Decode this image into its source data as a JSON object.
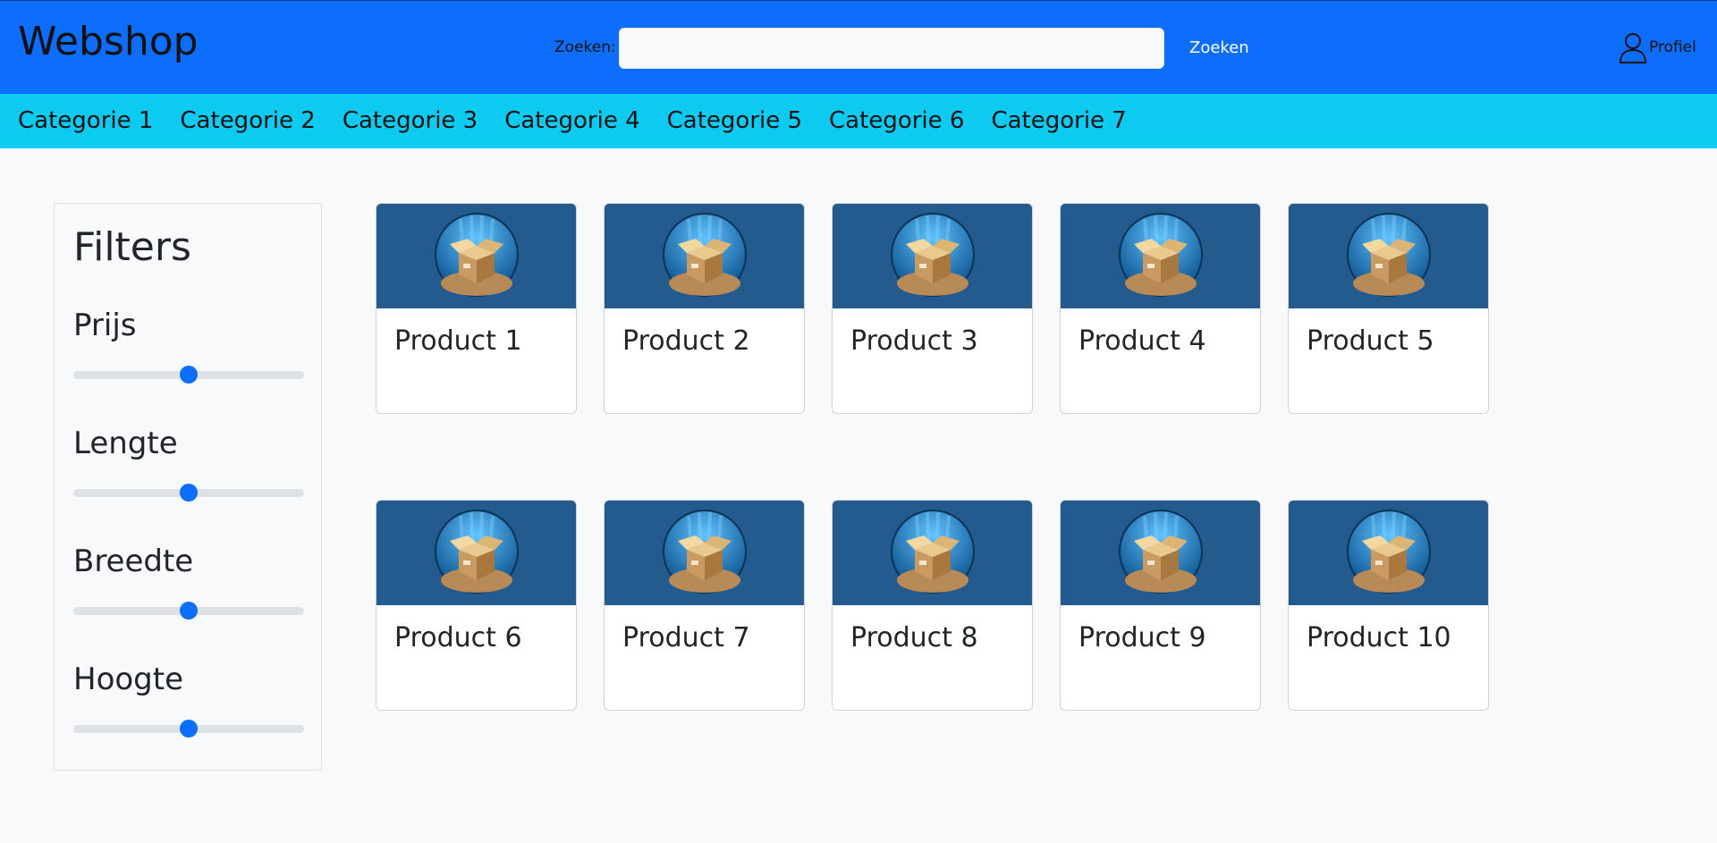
{
  "header": {
    "brand": "Webshop",
    "search_label": "Zoeken:",
    "search_value": "",
    "search_placeholder": "",
    "search_button": "Zoeken",
    "profile_label": "Profiel",
    "profile_icon": "person-icon"
  },
  "categories": [
    "Categorie 1",
    "Categorie 2",
    "Categorie 3",
    "Categorie 4",
    "Categorie 5",
    "Categorie 6",
    "Categorie 7"
  ],
  "filters": {
    "title": "Filters",
    "items": [
      {
        "label": "Prijs",
        "value": 50
      },
      {
        "label": "Lengte",
        "value": 50
      },
      {
        "label": "Breedte",
        "value": 50
      },
      {
        "label": "Hoogte",
        "value": 50
      }
    ]
  },
  "products": [
    {
      "name": "Product 1",
      "image_icon": "open-box-icon"
    },
    {
      "name": "Product 2",
      "image_icon": "open-box-icon"
    },
    {
      "name": "Product 3",
      "image_icon": "open-box-icon"
    },
    {
      "name": "Product 4",
      "image_icon": "open-box-icon"
    },
    {
      "name": "Product 5",
      "image_icon": "open-box-icon"
    },
    {
      "name": "Product 6",
      "image_icon": "open-box-icon"
    },
    {
      "name": "Product 7",
      "image_icon": "open-box-icon"
    },
    {
      "name": "Product 8",
      "image_icon": "open-box-icon"
    },
    {
      "name": "Product 9",
      "image_icon": "open-box-icon"
    },
    {
      "name": "Product 10",
      "image_icon": "open-box-icon"
    }
  ],
  "colors": {
    "header_bg": "#0d6efd",
    "category_bar_bg": "#0dcaf0",
    "page_bg": "#f8f9fa",
    "slider_thumb": "#0d6efd",
    "product_image_bg": "#245b8f"
  }
}
